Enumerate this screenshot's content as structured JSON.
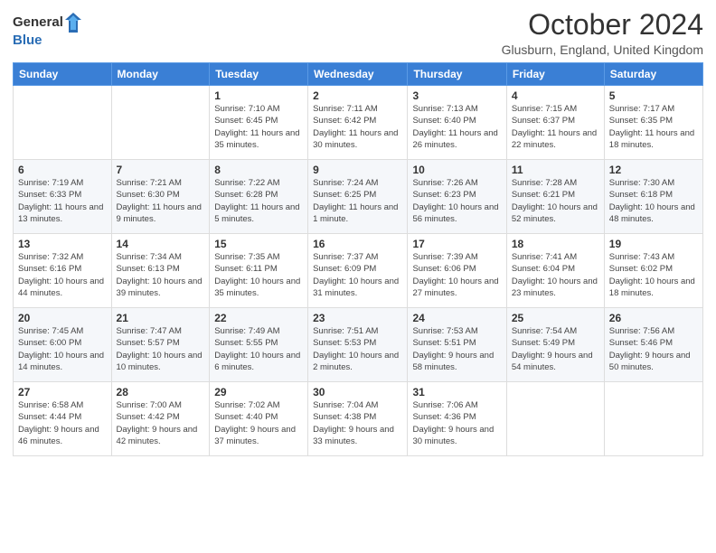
{
  "logo": {
    "general": "General",
    "blue": "Blue"
  },
  "header": {
    "title": "October 2024",
    "subtitle": "Glusburn, England, United Kingdom"
  },
  "weekdays": [
    "Sunday",
    "Monday",
    "Tuesday",
    "Wednesday",
    "Thursday",
    "Friday",
    "Saturday"
  ],
  "weeks": [
    [
      {
        "day": "",
        "sunrise": "",
        "sunset": "",
        "daylight": ""
      },
      {
        "day": "",
        "sunrise": "",
        "sunset": "",
        "daylight": ""
      },
      {
        "day": "1",
        "sunrise": "Sunrise: 7:10 AM",
        "sunset": "Sunset: 6:45 PM",
        "daylight": "Daylight: 11 hours and 35 minutes."
      },
      {
        "day": "2",
        "sunrise": "Sunrise: 7:11 AM",
        "sunset": "Sunset: 6:42 PM",
        "daylight": "Daylight: 11 hours and 30 minutes."
      },
      {
        "day": "3",
        "sunrise": "Sunrise: 7:13 AM",
        "sunset": "Sunset: 6:40 PM",
        "daylight": "Daylight: 11 hours and 26 minutes."
      },
      {
        "day": "4",
        "sunrise": "Sunrise: 7:15 AM",
        "sunset": "Sunset: 6:37 PM",
        "daylight": "Daylight: 11 hours and 22 minutes."
      },
      {
        "day": "5",
        "sunrise": "Sunrise: 7:17 AM",
        "sunset": "Sunset: 6:35 PM",
        "daylight": "Daylight: 11 hours and 18 minutes."
      }
    ],
    [
      {
        "day": "6",
        "sunrise": "Sunrise: 7:19 AM",
        "sunset": "Sunset: 6:33 PM",
        "daylight": "Daylight: 11 hours and 13 minutes."
      },
      {
        "day": "7",
        "sunrise": "Sunrise: 7:21 AM",
        "sunset": "Sunset: 6:30 PM",
        "daylight": "Daylight: 11 hours and 9 minutes."
      },
      {
        "day": "8",
        "sunrise": "Sunrise: 7:22 AM",
        "sunset": "Sunset: 6:28 PM",
        "daylight": "Daylight: 11 hours and 5 minutes."
      },
      {
        "day": "9",
        "sunrise": "Sunrise: 7:24 AM",
        "sunset": "Sunset: 6:25 PM",
        "daylight": "Daylight: 11 hours and 1 minute."
      },
      {
        "day": "10",
        "sunrise": "Sunrise: 7:26 AM",
        "sunset": "Sunset: 6:23 PM",
        "daylight": "Daylight: 10 hours and 56 minutes."
      },
      {
        "day": "11",
        "sunrise": "Sunrise: 7:28 AM",
        "sunset": "Sunset: 6:21 PM",
        "daylight": "Daylight: 10 hours and 52 minutes."
      },
      {
        "day": "12",
        "sunrise": "Sunrise: 7:30 AM",
        "sunset": "Sunset: 6:18 PM",
        "daylight": "Daylight: 10 hours and 48 minutes."
      }
    ],
    [
      {
        "day": "13",
        "sunrise": "Sunrise: 7:32 AM",
        "sunset": "Sunset: 6:16 PM",
        "daylight": "Daylight: 10 hours and 44 minutes."
      },
      {
        "day": "14",
        "sunrise": "Sunrise: 7:34 AM",
        "sunset": "Sunset: 6:13 PM",
        "daylight": "Daylight: 10 hours and 39 minutes."
      },
      {
        "day": "15",
        "sunrise": "Sunrise: 7:35 AM",
        "sunset": "Sunset: 6:11 PM",
        "daylight": "Daylight: 10 hours and 35 minutes."
      },
      {
        "day": "16",
        "sunrise": "Sunrise: 7:37 AM",
        "sunset": "Sunset: 6:09 PM",
        "daylight": "Daylight: 10 hours and 31 minutes."
      },
      {
        "day": "17",
        "sunrise": "Sunrise: 7:39 AM",
        "sunset": "Sunset: 6:06 PM",
        "daylight": "Daylight: 10 hours and 27 minutes."
      },
      {
        "day": "18",
        "sunrise": "Sunrise: 7:41 AM",
        "sunset": "Sunset: 6:04 PM",
        "daylight": "Daylight: 10 hours and 23 minutes."
      },
      {
        "day": "19",
        "sunrise": "Sunrise: 7:43 AM",
        "sunset": "Sunset: 6:02 PM",
        "daylight": "Daylight: 10 hours and 18 minutes."
      }
    ],
    [
      {
        "day": "20",
        "sunrise": "Sunrise: 7:45 AM",
        "sunset": "Sunset: 6:00 PM",
        "daylight": "Daylight: 10 hours and 14 minutes."
      },
      {
        "day": "21",
        "sunrise": "Sunrise: 7:47 AM",
        "sunset": "Sunset: 5:57 PM",
        "daylight": "Daylight: 10 hours and 10 minutes."
      },
      {
        "day": "22",
        "sunrise": "Sunrise: 7:49 AM",
        "sunset": "Sunset: 5:55 PM",
        "daylight": "Daylight: 10 hours and 6 minutes."
      },
      {
        "day": "23",
        "sunrise": "Sunrise: 7:51 AM",
        "sunset": "Sunset: 5:53 PM",
        "daylight": "Daylight: 10 hours and 2 minutes."
      },
      {
        "day": "24",
        "sunrise": "Sunrise: 7:53 AM",
        "sunset": "Sunset: 5:51 PM",
        "daylight": "Daylight: 9 hours and 58 minutes."
      },
      {
        "day": "25",
        "sunrise": "Sunrise: 7:54 AM",
        "sunset": "Sunset: 5:49 PM",
        "daylight": "Daylight: 9 hours and 54 minutes."
      },
      {
        "day": "26",
        "sunrise": "Sunrise: 7:56 AM",
        "sunset": "Sunset: 5:46 PM",
        "daylight": "Daylight: 9 hours and 50 minutes."
      }
    ],
    [
      {
        "day": "27",
        "sunrise": "Sunrise: 6:58 AM",
        "sunset": "Sunset: 4:44 PM",
        "daylight": "Daylight: 9 hours and 46 minutes."
      },
      {
        "day": "28",
        "sunrise": "Sunrise: 7:00 AM",
        "sunset": "Sunset: 4:42 PM",
        "daylight": "Daylight: 9 hours and 42 minutes."
      },
      {
        "day": "29",
        "sunrise": "Sunrise: 7:02 AM",
        "sunset": "Sunset: 4:40 PM",
        "daylight": "Daylight: 9 hours and 37 minutes."
      },
      {
        "day": "30",
        "sunrise": "Sunrise: 7:04 AM",
        "sunset": "Sunset: 4:38 PM",
        "daylight": "Daylight: 9 hours and 33 minutes."
      },
      {
        "day": "31",
        "sunrise": "Sunrise: 7:06 AM",
        "sunset": "Sunset: 4:36 PM",
        "daylight": "Daylight: 9 hours and 30 minutes."
      },
      {
        "day": "",
        "sunrise": "",
        "sunset": "",
        "daylight": ""
      },
      {
        "day": "",
        "sunrise": "",
        "sunset": "",
        "daylight": ""
      }
    ]
  ]
}
